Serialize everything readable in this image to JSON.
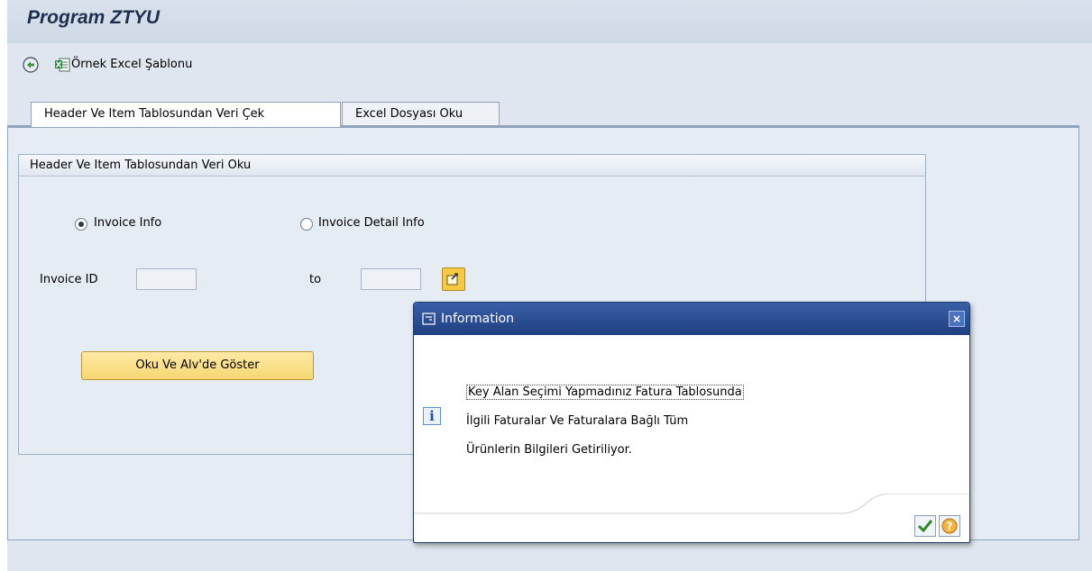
{
  "window": {
    "title": "Program ZTYU"
  },
  "toolbar": {
    "excel_template_label": "Örnek Excel Şablonu"
  },
  "tabs": [
    {
      "label": "Header Ve Item Tablosundan Veri Çek",
      "active": true
    },
    {
      "label": "Excel Dosyası Oku",
      "active": false
    }
  ],
  "group": {
    "title": "Header Ve Item Tablosundan Veri Oku",
    "radio_invoice_info": "Invoice Info",
    "radio_invoice_detail": "Invoice Detail Info",
    "invoice_id_label": "Invoice ID",
    "to_label": "to",
    "invoice_id_from": "",
    "invoice_id_to": "",
    "show_button": "Oku Ve Alv'de Göster"
  },
  "dialog": {
    "title": "Information",
    "close": "×",
    "line1": "Key Alan Seçimi Yapmadınız Fatura Tablosunda",
    "line2": "İlgili Faturalar Ve Faturalara Bağlı Tüm",
    "line3": "Ürünlerin Bilgileri Getiriliyor.",
    "info_icon": "i"
  },
  "colors": {
    "accent_blue": "#1e3f80",
    "button_yellow": "#f7d774",
    "panel_bg": "#e6ecf4"
  }
}
